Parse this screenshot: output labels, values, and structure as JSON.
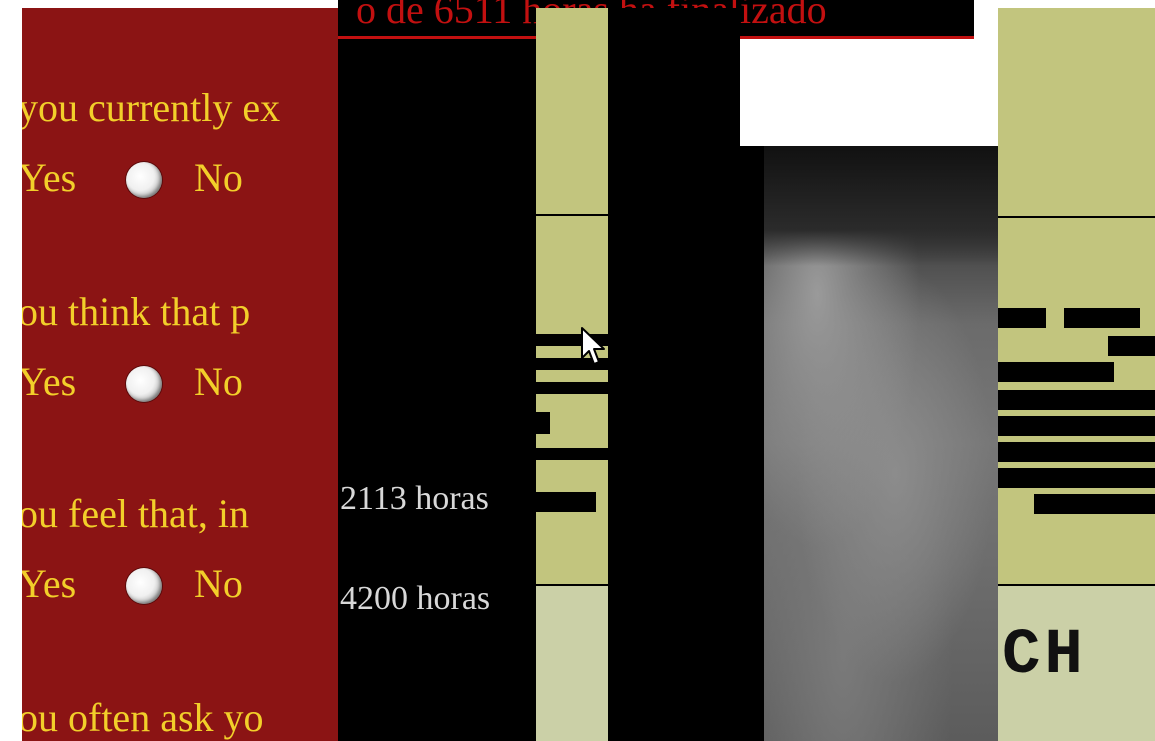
{
  "header": {
    "link_text": "o de 6511 horas ha finalizado"
  },
  "survey": {
    "questions": [
      {
        "text": "you currently ex"
      },
      {
        "text": "ou think that p"
      },
      {
        "text": "ou feel that, in"
      },
      {
        "text": "ou often ask yo"
      }
    ],
    "yes_label": "Yes",
    "no_label": "No"
  },
  "hours": [
    {
      "text": "2113 horas"
    },
    {
      "text": "4200 horas"
    }
  ],
  "right_panel": {
    "partial_text": "CH"
  },
  "colors": {
    "panel_red": "#8b1414",
    "survey_text": "#f2cf2a",
    "link_red": "#c21010",
    "olive": "#c2c57e",
    "pale_olive": "#cbd0a7"
  },
  "icons": {
    "cursor": "arrow-pointer-icon",
    "radio": "radio-button-icon"
  }
}
